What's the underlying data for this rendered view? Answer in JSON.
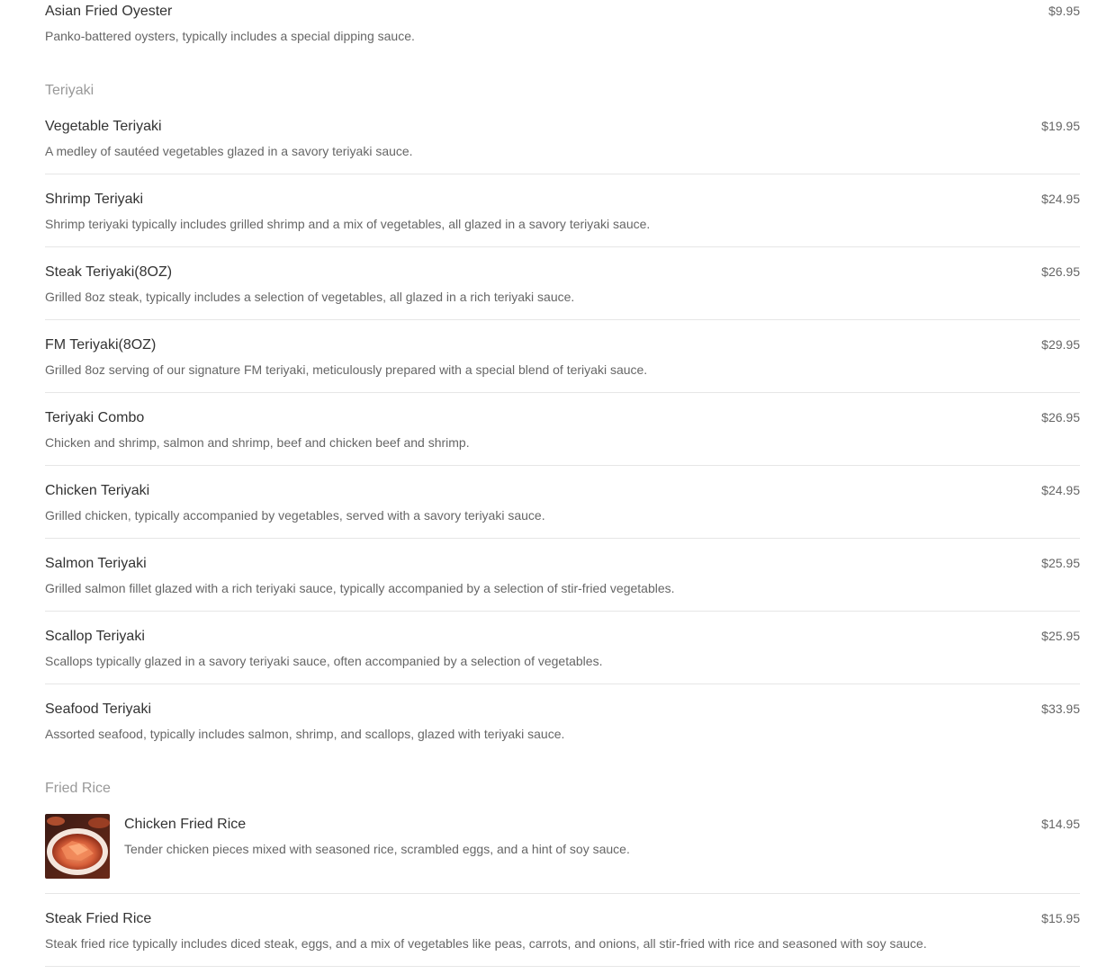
{
  "sections": {
    "appetizers_tail": {
      "items": [
        {
          "name": "Asian Fried Oyester",
          "description": "Panko-battered oysters, typically includes a special dipping sauce.",
          "price": "$9.95"
        }
      ]
    },
    "teriyaki": {
      "title": "Teriyaki",
      "items": [
        {
          "name": "Vegetable Teriyaki",
          "description": "A medley of sautéed vegetables glazed in a savory teriyaki sauce.",
          "price": "$19.95"
        },
        {
          "name": "Shrimp Teriyaki",
          "description": "Shrimp teriyaki typically includes grilled shrimp and a mix of vegetables, all glazed in a savory teriyaki sauce.",
          "price": "$24.95"
        },
        {
          "name": "Steak Teriyaki(8OZ)",
          "description": "Grilled 8oz steak, typically includes a selection of vegetables, all glazed in a rich teriyaki sauce.",
          "price": "$26.95"
        },
        {
          "name": "FM Teriyaki(8OZ)",
          "description": "Grilled 8oz serving of our signature FM teriyaki, meticulously prepared with a special blend of teriyaki sauce.",
          "price": "$29.95"
        },
        {
          "name": "Teriyaki Combo",
          "description": "Chicken and shrimp, salmon and shrimp, beef and chicken beef and shrimp.",
          "price": "$26.95"
        },
        {
          "name": "Chicken Teriyaki",
          "description": "Grilled chicken, typically accompanied by vegetables, served with a savory teriyaki sauce.",
          "price": "$24.95"
        },
        {
          "name": "Salmon Teriyaki",
          "description": "Grilled salmon fillet glazed with a rich teriyaki sauce, typically accompanied by a selection of stir-fried vegetables.",
          "price": "$25.95"
        },
        {
          "name": "Scallop Teriyaki",
          "description": "Scallops typically glazed in a savory teriyaki sauce, often accompanied by a selection of vegetables.",
          "price": "$25.95"
        },
        {
          "name": "Seafood Teriyaki",
          "description": "Assorted seafood, typically includes salmon, shrimp, and scallops, glazed with teriyaki sauce.",
          "price": "$33.95"
        }
      ]
    },
    "fried_rice": {
      "title": "Fried Rice",
      "items": [
        {
          "name": "Chicken Fried Rice",
          "description": "Tender chicken pieces mixed with seasoned rice, scrambled eggs, and a hint of soy sauce.",
          "price": "$14.95"
        },
        {
          "name": "Steak Fried Rice",
          "description": "Steak fried rice typically includes diced steak, eggs, and a mix of vegetables like peas, carrots, and onions, all stir-fried with rice and seasoned with soy sauce.",
          "price": "$15.95"
        }
      ]
    }
  }
}
